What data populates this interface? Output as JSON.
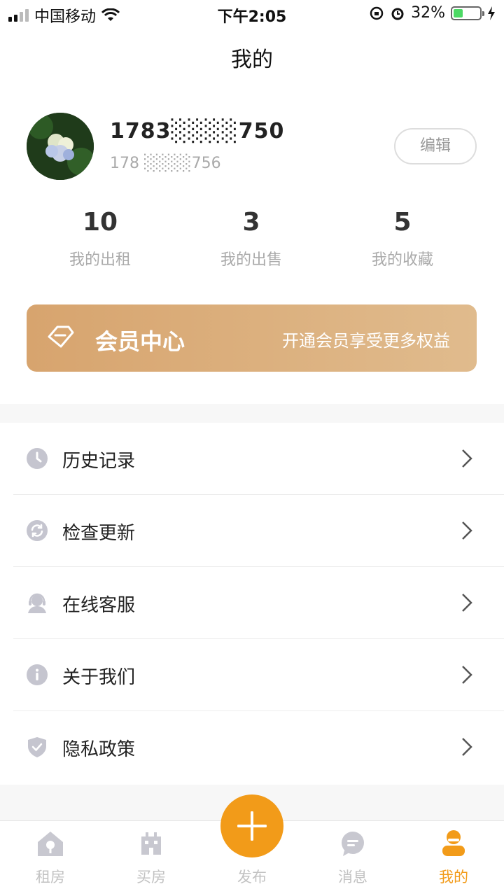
{
  "status_bar": {
    "carrier": "中国移动",
    "time": "下午2:05",
    "battery_percent": "32%",
    "battery_level": 0.32
  },
  "header": {
    "title": "我的"
  },
  "profile": {
    "name": "1783░░░░750",
    "phone": "178 ░░░░756",
    "edit_label": "编辑"
  },
  "stats": [
    {
      "value": "10",
      "label": "我的出租"
    },
    {
      "value": "3",
      "label": "我的出售"
    },
    {
      "value": "5",
      "label": "我的收藏"
    }
  ],
  "vip": {
    "title": "会员中心",
    "subtitle": "开通会员享受更多权益",
    "icon": "diamond-icon"
  },
  "menu": [
    {
      "label": "历史记录",
      "icon": "clock-icon"
    },
    {
      "label": "检查更新",
      "icon": "refresh-icon"
    },
    {
      "label": "在线客服",
      "icon": "headset-icon"
    },
    {
      "label": "关于我们",
      "icon": "info-icon"
    },
    {
      "label": "隐私政策",
      "icon": "shield-icon"
    }
  ],
  "tabbar": {
    "items": [
      {
        "label": "租房",
        "icon": "house-icon"
      },
      {
        "label": "买房",
        "icon": "building-icon"
      },
      {
        "label": "发布",
        "icon": "plus-icon"
      },
      {
        "label": "消息",
        "icon": "message-icon"
      },
      {
        "label": "我的",
        "icon": "user-icon"
      }
    ],
    "active": "我的"
  },
  "colors": {
    "accent": "#f29b19",
    "vip_gradient_start": "#d7a46e",
    "vip_gradient_end": "#e0bb8d",
    "icon_gray": "#c5c5cf",
    "page_bg": "#f7f7f7"
  }
}
